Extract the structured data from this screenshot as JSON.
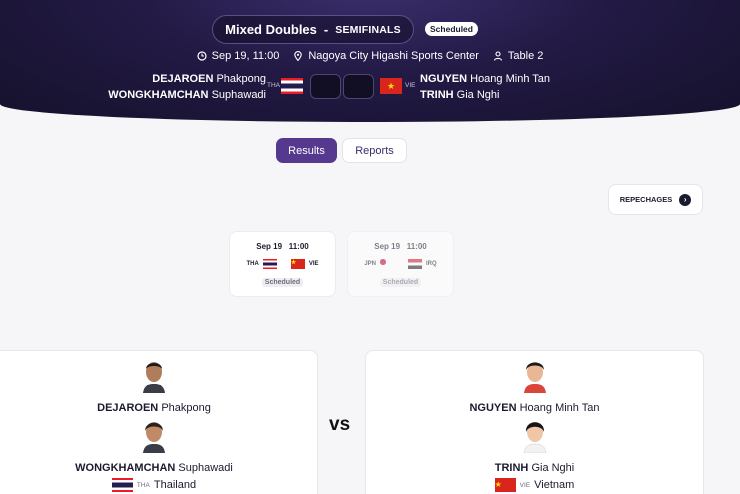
{
  "header": {
    "event": "Mixed Doubles",
    "separator": "-",
    "phase": "SEMIFINALS",
    "status": "Scheduled",
    "date_time": "Sep 19, 11:00",
    "venue": "Nagoya City Higashi Sports Center",
    "table": "Table 2",
    "left_team": {
      "noc": "THA",
      "players": [
        {
          "surname": "DEJAROEN",
          "given": "Phakpong"
        },
        {
          "surname": "WONGKHAMCHAN",
          "given": "Suphawadi"
        }
      ]
    },
    "right_team": {
      "noc": "VIE",
      "players": [
        {
          "surname": "NGUYEN",
          "given": "Hoang Minh Tan"
        },
        {
          "surname": "TRINH",
          "given": "Gia Nghi"
        }
      ]
    }
  },
  "tabs": [
    "Results",
    "Reports"
  ],
  "active_tab": "Results",
  "repechages_label": "REPECHAGES",
  "matches": [
    {
      "date": "Sep 19",
      "time": "11:00",
      "left_noc": "THA",
      "right_noc": "VIE",
      "status": "Scheduled"
    },
    {
      "date": "Sep 19",
      "time": "11:00",
      "left_noc": "JPN",
      "right_noc": "IRQ",
      "status": "Scheduled"
    }
  ],
  "teams": {
    "left": {
      "players": [
        {
          "surname": "DEJAROEN",
          "given": "Phakpong"
        },
        {
          "surname": "WONGKHAMCHAN",
          "given": "Suphawadi"
        }
      ],
      "noc": "THA",
      "country": "Thailand"
    },
    "right": {
      "players": [
        {
          "surname": "NGUYEN",
          "given": "Hoang Minh Tan"
        },
        {
          "surname": "TRINH",
          "given": "Gia Nghi"
        }
      ],
      "noc": "VIE",
      "country": "Vietnam"
    },
    "vs_label": "vs"
  },
  "colors": {
    "header_bg": "#231a45",
    "accent": "#55398f",
    "page_bg": "#f6f6f8"
  },
  "icons": [
    "calendar-icon",
    "location-pin-icon",
    "table-person-icon",
    "chevron-right-icon"
  ]
}
